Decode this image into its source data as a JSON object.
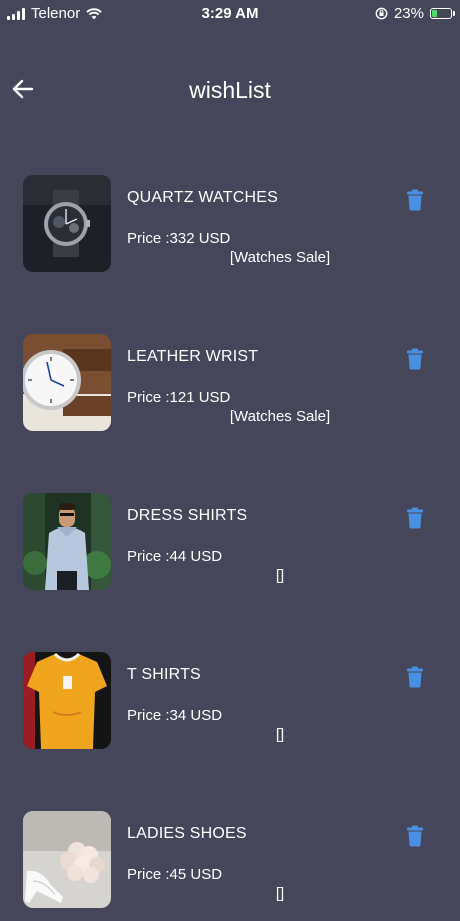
{
  "status_bar": {
    "carrier": "Telenor",
    "time": "3:29 AM",
    "battery": "23%"
  },
  "header": {
    "title": "wishList",
    "back_icon": "arrow-left-icon"
  },
  "colors": {
    "background": "#454659",
    "text": "#ffffff",
    "delete_icon": "#4a90e2"
  },
  "items": [
    {
      "name": "QUARTZ WATCHES",
      "price": "Price :332 USD",
      "category": "[Watches Sale]",
      "image": "quartz-watch"
    },
    {
      "name": "LEATHER WRIST",
      "price": "Price :121 USD",
      "category": "[Watches Sale]",
      "image": "leather-watch"
    },
    {
      "name": "DRESS SHIRTS",
      "price": "Price :44 USD",
      "category": "[]",
      "image": "dress-shirt-man"
    },
    {
      "name": "T SHIRTS",
      "price": "Price :34 USD",
      "category": "[]",
      "image": "yellow-tshirt"
    },
    {
      "name": "LADIES SHOES",
      "price": "Price :45 USD",
      "category": "[]",
      "image": "white-heels-flowers"
    }
  ]
}
